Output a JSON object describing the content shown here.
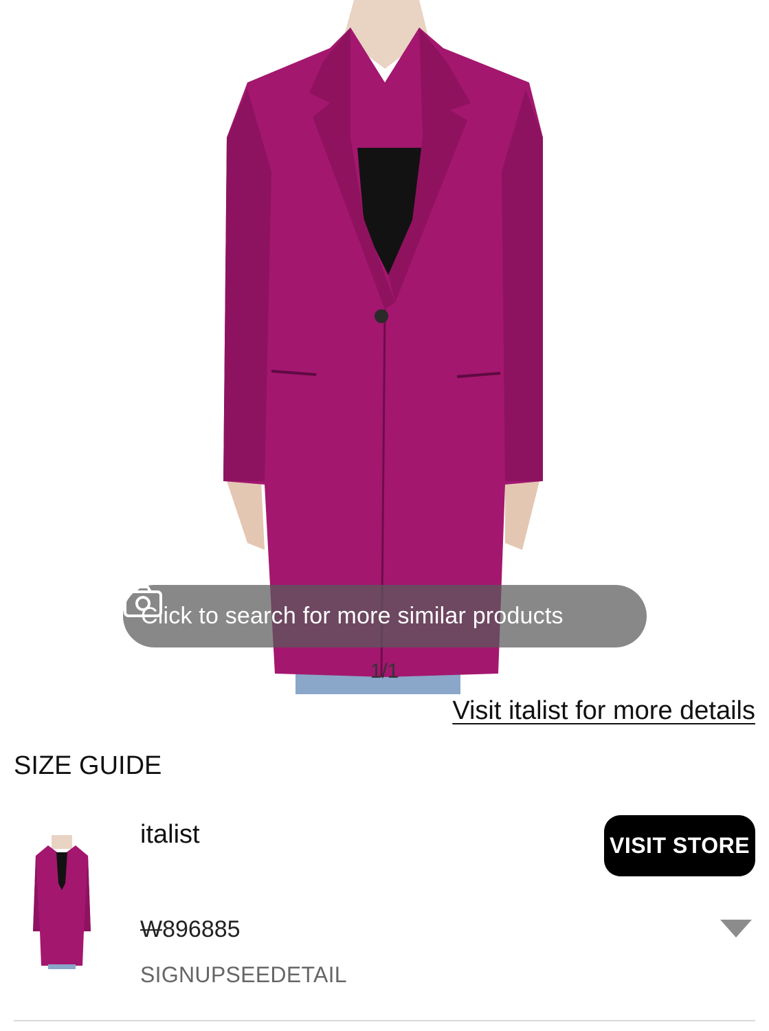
{
  "colors": {
    "coat": "#a3176f",
    "coat_shadow": "#7c0f55",
    "undershirt": "#121212",
    "skin": "#e9d3c3",
    "jeans": "#8aa6c8",
    "pill_bg": "rgba(90,90,90,0.72)",
    "button_bg": "#000000",
    "divider": "#d8d8d8"
  },
  "product_image": {
    "alt": "magenta wool coat"
  },
  "similar_search": {
    "icon": "camera-icon",
    "label": "Click to search for more similar products"
  },
  "pager": {
    "text": "1/1"
  },
  "visit_link": {
    "label": "Visit italist for more details"
  },
  "size_guide": {
    "label": "SIZE GUIDE"
  },
  "offer": {
    "store_name": "italist",
    "visit_store_label": "VISIT STORE",
    "currency_symbol": "W",
    "price_value": "896885",
    "signup_text": "SIGNUPSEEDETAIL",
    "expand_icon": "triangle-down-icon"
  }
}
